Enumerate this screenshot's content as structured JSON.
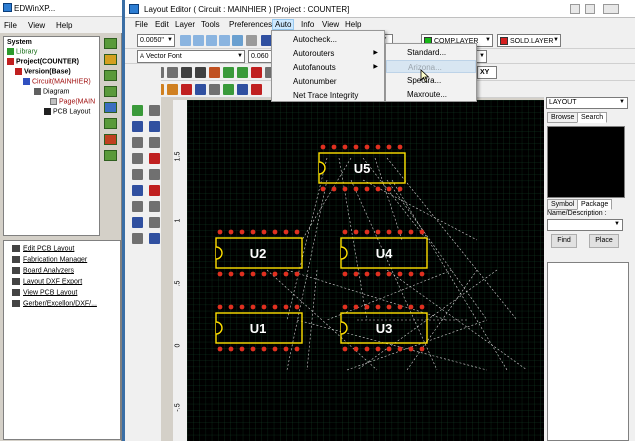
{
  "left_window": {
    "title": "EDWinXP...",
    "menu": [
      "File",
      "View",
      "Help"
    ],
    "tree": [
      {
        "label": "System",
        "bold": true
      },
      {
        "label": "Library",
        "bold": false
      },
      {
        "label": "Project(COUNTER)",
        "bold": true
      },
      {
        "label": "Version(Base)",
        "bold": true
      },
      {
        "label": "Circuit(MAINHIER)",
        "bold": false
      },
      {
        "label": "Diagram",
        "bold": false
      },
      {
        "label": "Page(MAIN",
        "bold": false
      },
      {
        "label": "PCB Layout",
        "bold": false
      }
    ],
    "tools": [
      "Edit PCB Layout",
      "Fabrication Manager",
      "Board Analyzers",
      "Layout DXF Export",
      "View PCB Layout",
      "Gerber/Excellon/DXF/..."
    ]
  },
  "editor": {
    "title": "Layout Editor ( Circuit : MAINHIER ) [Project : COUNTER]",
    "menu": [
      "File",
      "Edit",
      "Layer",
      "Tools",
      "Preferences",
      "Auto",
      "Info",
      "View",
      "Help"
    ],
    "active_menu": "Auto",
    "grid_combo": "0.0050\"",
    "font_combo": "Vector Font",
    "font_size_combo": "0.060",
    "layer_top": "COMP.LAYER",
    "layer_bottom": "SOLD.LAYER",
    "coord_combo": "0\"",
    "xy_label": "XY",
    "ruler_labels": [
      "1.5",
      "1",
      ".5",
      "0",
      "-.5"
    ]
  },
  "auto_menu": {
    "items": [
      {
        "label": "Autocheck...",
        "submenu": false
      },
      {
        "label": "Autorouters",
        "submenu": true
      },
      {
        "label": "Autofanouts",
        "submenu": true
      },
      {
        "label": "Autonumber",
        "submenu": false
      },
      {
        "label": "Net Trace Integrity",
        "submenu": false
      }
    ]
  },
  "autorouters_submenu": {
    "items": [
      "Standard...",
      "Arizona...",
      "Spectra...",
      "Maxroute..."
    ],
    "highlighted": "Arizona..."
  },
  "components": [
    "U5",
    "U2",
    "U4",
    "U1",
    "U3"
  ],
  "right_panel": {
    "library_combo": "LAYOUT",
    "tabs_top": [
      "Browse",
      "Search"
    ],
    "active_tab": "Search",
    "tabs_bottom": [
      "Symbol",
      "Package"
    ],
    "active_bottom_tab": "Package",
    "name_label": "Name/Description :",
    "find_label": "Find",
    "place_label": "Place"
  },
  "colors": {
    "comp_layer": "#18b818",
    "sold_layer": "#d42020",
    "board_outline": "#ffe000",
    "pad_red": "#e03020",
    "grid": "#1f5f3a"
  }
}
